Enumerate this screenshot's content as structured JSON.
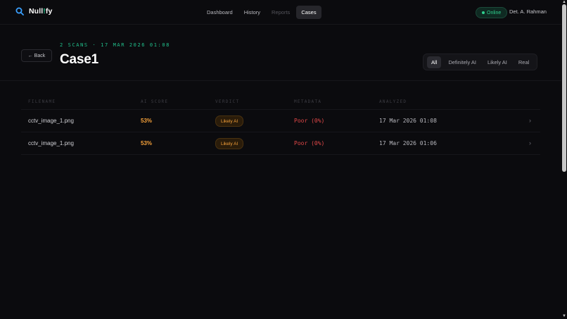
{
  "app": {
    "logo_parts": [
      "Null",
      "!",
      "fy"
    ]
  },
  "nav": {
    "items": [
      {
        "label": "Dashboard",
        "state": "normal"
      },
      {
        "label": "History",
        "state": "normal"
      },
      {
        "label": "Reports",
        "state": "disabled"
      },
      {
        "label": "Cases",
        "state": "active"
      }
    ]
  },
  "status": {
    "label": "Online",
    "color": "#2fd08f"
  },
  "user": {
    "name": "Det. A. Rahman"
  },
  "header": {
    "back_label": "← Back",
    "meta_line": "2 SCANS · 17 MAR 2026 01:08",
    "title": "Case1"
  },
  "filters": {
    "items": [
      "All",
      "Definitely AI",
      "Likely AI",
      "Real"
    ],
    "selected": "All"
  },
  "table": {
    "columns": [
      "FILENAME",
      "AI SCORE",
      "VERDICT",
      "METADATA",
      "ANALYZED"
    ],
    "rows": [
      {
        "filename": "cctv_image_1.png",
        "score": "53%",
        "verdict": "Likely AI",
        "metadata": "Poor (0%)",
        "analyzed": "17 Mar 2026 01:08",
        "chevron": "›"
      },
      {
        "filename": "cctv_image_1.png",
        "score": "53%",
        "verdict": "Likely AI",
        "metadata": "Poor (0%)",
        "analyzed": "17 Mar 2026 01:06",
        "chevron": "›"
      }
    ]
  },
  "colors": {
    "accent": "#21c08b",
    "score": "#f5a13a",
    "metadata_poor": "#e24848",
    "background": "#0b0b0e"
  },
  "icons": {
    "logo": "magnifier-icon",
    "row_action": "chevron-right-icon"
  }
}
